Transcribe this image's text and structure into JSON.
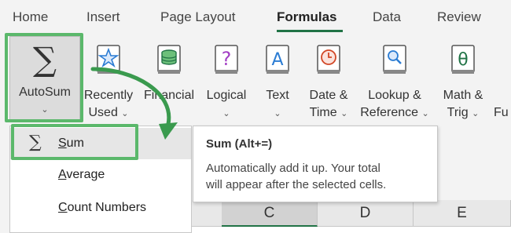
{
  "tabs": [
    "Home",
    "Insert",
    "Page Layout",
    "Formulas",
    "Data",
    "Review"
  ],
  "active_tab": "Formulas",
  "ribbon": {
    "autosum": {
      "label": "AutoSum",
      "icon": "sigma-icon"
    },
    "buttons": [
      {
        "line1": "Recently",
        "line2": "Used",
        "icon": "star-book-icon"
      },
      {
        "line1": "Financial",
        "line2": "",
        "icon": "money-book-icon"
      },
      {
        "line1": "Logical",
        "line2": "",
        "icon": "question-book-icon"
      },
      {
        "line1": "Text",
        "line2": "",
        "icon": "text-book-icon"
      },
      {
        "line1": "Date &",
        "line2": "Time",
        "icon": "clock-book-icon"
      },
      {
        "line1": "Lookup &",
        "line2": "Reference",
        "icon": "magnifier-book-icon"
      },
      {
        "line1": "Math &",
        "line2": "Trig",
        "icon": "theta-book-icon"
      },
      {
        "line1": "Fu",
        "line2": "",
        "icon": ""
      }
    ]
  },
  "menu": {
    "items": [
      {
        "label_u": "S",
        "label_rest": "um",
        "selected": true,
        "icon": "sigma-icon"
      },
      {
        "label_u": "A",
        "label_rest": "verage",
        "selected": false
      },
      {
        "label_u": "C",
        "label_rest": "ount Numbers",
        "selected": false
      }
    ]
  },
  "tooltip": {
    "title": "Sum (Alt+=)",
    "line1": "Automatically add it up. Your total",
    "line2": "will appear after the selected cells."
  },
  "columns": [
    "C",
    "D",
    "E"
  ],
  "selected_column": "C",
  "colors": {
    "accent": "#217346",
    "highlight": "#5bb86b",
    "arrow": "#3a9a4e"
  }
}
